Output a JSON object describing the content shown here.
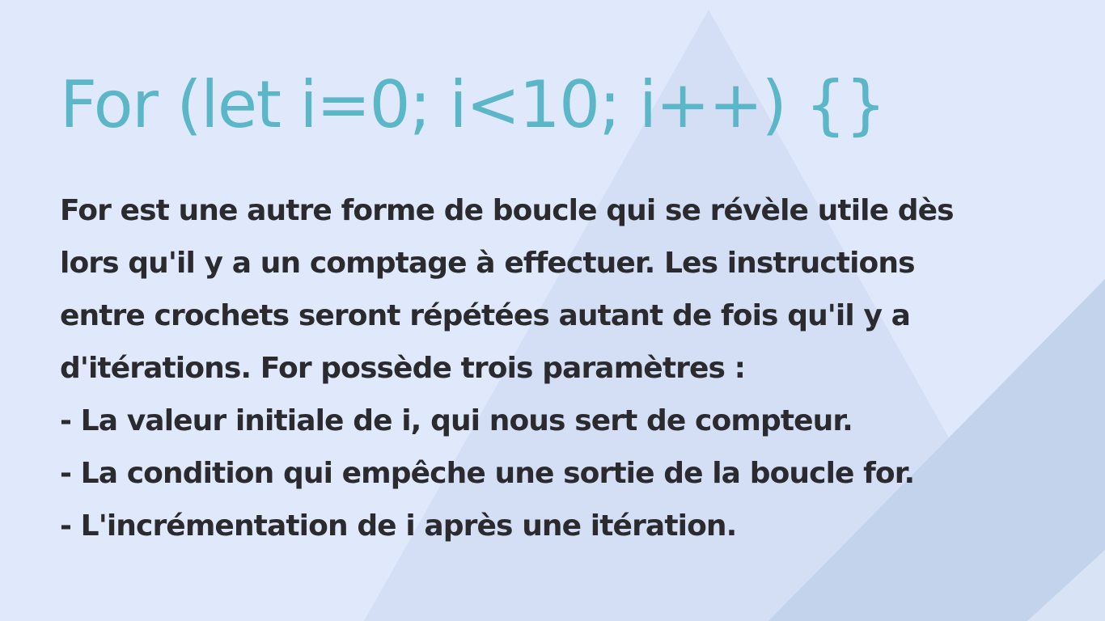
{
  "slide": {
    "title": "For (let i=0; i<10; i++) {}",
    "body_lines": [
      "For est une autre forme de boucle qui se révèle utile dès",
      "lors qu'il y a un comptage à effectuer. Les instructions",
      "entre crochets seront répétées autant de fois qu'il y a",
      "d'itérations. For possède trois paramètres :",
      "- La valeur initiale de i, qui nous sert de compteur.",
      "- La condition qui empêche une sortie de la boucle for.",
      "- L'incrémentation de i après une itération."
    ]
  },
  "colors": {
    "background": "#dfe9fb",
    "title": "#5bb6c8",
    "body_text": "#2b2b2f",
    "shape_light": "#d3def5",
    "shape_dark": "#c3d2ea"
  }
}
